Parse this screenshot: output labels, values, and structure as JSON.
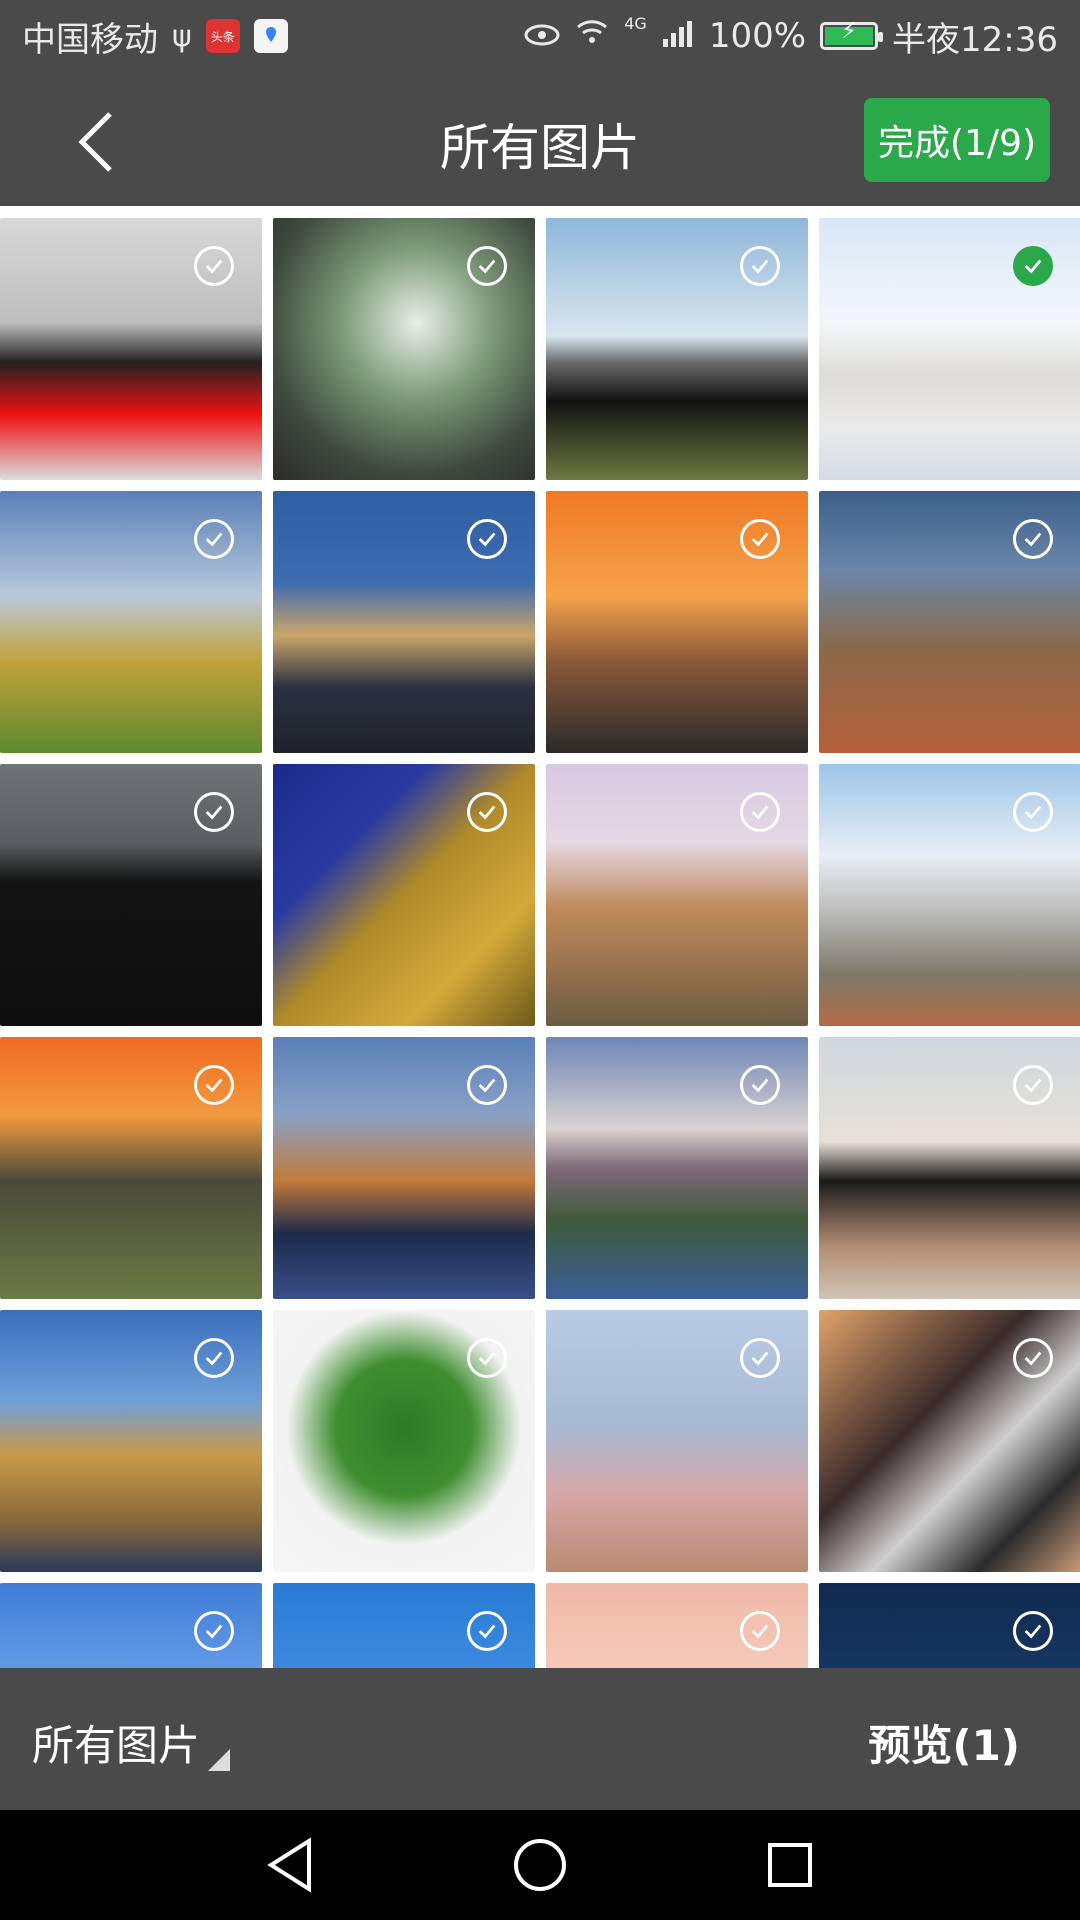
{
  "status_bar": {
    "carrier": "中国移动",
    "network": "4G",
    "battery": "100%",
    "time": "半夜12:36",
    "toutiao_label": "头条"
  },
  "header": {
    "title": "所有图片",
    "done_label": "完成(1/9)"
  },
  "grid": {
    "tiles": [
      {
        "subject": "woman-red-skirt",
        "selected": false
      },
      {
        "subject": "snowdrop-flowers",
        "selected": false
      },
      {
        "subject": "black-sports-car",
        "selected": false
      },
      {
        "subject": "river-bridge-town",
        "selected": true
      },
      {
        "subject": "chocolate-hills",
        "selected": false
      },
      {
        "subject": "city-waterfront-dusk",
        "selected": false
      },
      {
        "subject": "prague-sunset",
        "selected": false
      },
      {
        "subject": "prague-church",
        "selected": false
      },
      {
        "subject": "man-black-suit",
        "selected": false
      },
      {
        "subject": "colosseum-arches",
        "selected": false
      },
      {
        "subject": "walled-town",
        "selected": false
      },
      {
        "subject": "white-hill-village",
        "selected": false
      },
      {
        "subject": "great-wall-sunset",
        "selected": false
      },
      {
        "subject": "stockholm-night",
        "selected": false
      },
      {
        "subject": "mountain-lake",
        "selected": false
      },
      {
        "subject": "woman-black-blazer",
        "selected": false
      },
      {
        "subject": "hanging-houses",
        "selected": false
      },
      {
        "subject": "green-plant-vase",
        "selected": false
      },
      {
        "subject": "pink-sofa-interior",
        "selected": false
      },
      {
        "subject": "street-fashion-woman",
        "selected": false
      },
      {
        "subject": "cathedral-tower",
        "selected": false
      },
      {
        "subject": "blue-sky",
        "selected": false
      },
      {
        "subject": "coastal-cliffs",
        "selected": false
      },
      {
        "subject": "city-skyline-night",
        "selected": false
      }
    ]
  },
  "bottom": {
    "album_label": "所有图片",
    "preview_label": "预览(1)"
  },
  "colors": {
    "accent": "#2aa84a",
    "bar": "#4a4a4a"
  }
}
